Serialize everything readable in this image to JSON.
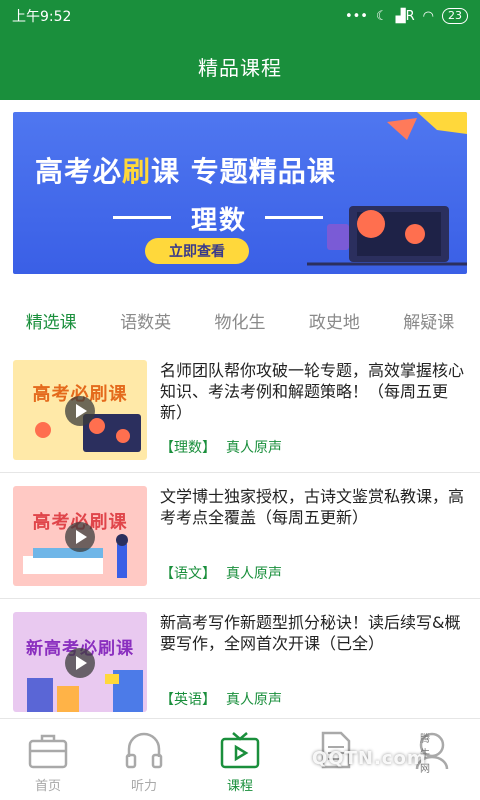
{
  "status": {
    "time": "上午9:52",
    "signal": "R",
    "battery": "23"
  },
  "title": "精品课程",
  "banner": {
    "title_part1": "高考必",
    "title_highlight": "刷",
    "title_part2": "课 专题精品课",
    "subtitle": "理数",
    "button": "立即查看"
  },
  "tabs": [
    {
      "label": "精选课"
    },
    {
      "label": "语数英"
    },
    {
      "label": "物化生"
    },
    {
      "label": "政史地"
    },
    {
      "label": "解疑课"
    }
  ],
  "courses": [
    {
      "thumb_text": "高考必刷课",
      "description": "名师团队帮你攻破一轮专题，高效掌握核心知识、考法考例和解题策略！（每周五更新）",
      "subject": "【理数】",
      "voice": "真人原声"
    },
    {
      "thumb_text": "高考必刷课",
      "description": "文学博士独家授权，古诗文鉴赏私教课，高考考点全覆盖（每周五更新）",
      "subject": "【语文】",
      "voice": "真人原声"
    },
    {
      "thumb_text": "新高考必刷课",
      "description": "新高考写作新题型抓分秘诀！读后续写&概要写作，全网首次开课（已全）",
      "subject": "【英语】",
      "voice": "真人原声"
    }
  ],
  "nav": [
    {
      "label": "首页",
      "icon": "briefcase-icon"
    },
    {
      "label": "听力",
      "icon": "headphones-icon"
    },
    {
      "label": "课程",
      "icon": "video-icon"
    },
    {
      "label": "",
      "icon": "document-icon"
    },
    {
      "label": "",
      "icon": "profile-icon"
    }
  ],
  "watermark": {
    "text": "QQTN.com",
    "sub": "腾牛网"
  },
  "colors": {
    "primary": "#1a8f3c",
    "banner": "#3a5fe6",
    "accent": "#ffd83b"
  }
}
